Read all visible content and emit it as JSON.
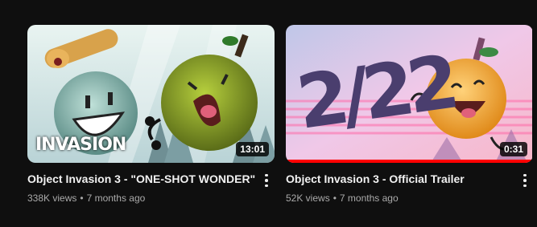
{
  "videos": [
    {
      "title": "Object Invasion 3 - \"ONE-SHOT WONDER\"",
      "views": "338K views",
      "age": "7 months ago",
      "duration": "13:01",
      "thumb_logo": "INVASION",
      "watched_fraction": 0,
      "menu_icon": "more-vert-icon"
    },
    {
      "title": "Object Invasion 3 - Official Trailer",
      "views": "52K views",
      "age": "7 months ago",
      "duration": "0:31",
      "thumb_text": "2/22",
      "watched_fraction": 1.0,
      "menu_icon": "more-vert-icon"
    }
  ],
  "colors": {
    "background": "#0f0f0f",
    "progress": "#ff0000",
    "secondary_text": "#aaaaaa"
  }
}
